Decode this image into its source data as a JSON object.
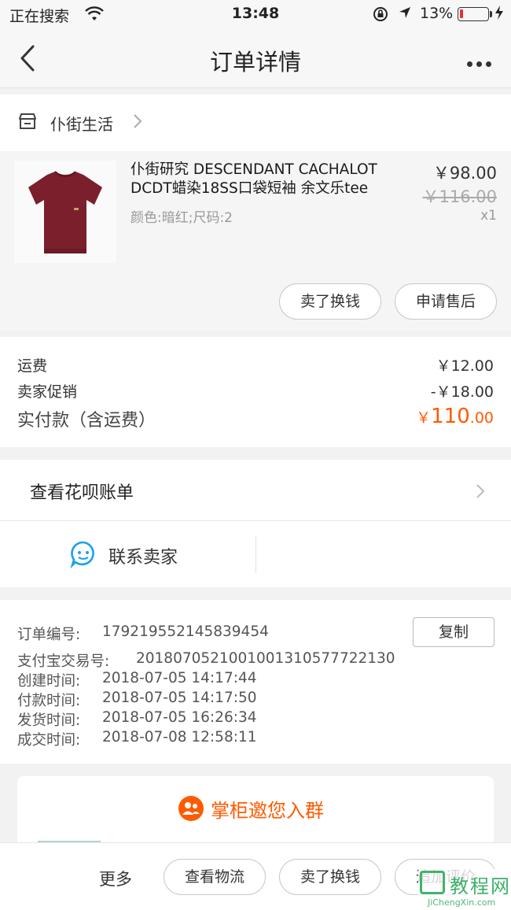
{
  "status_bar": {
    "carrier": "正在搜索",
    "time": "13:48",
    "battery_pct": "13%",
    "battery_level": 0.13,
    "battery_color": "#e83030"
  },
  "nav": {
    "title": "订单详情",
    "back_icon": "chevron-left-icon",
    "more_icon": "more-dots-icon"
  },
  "store": {
    "name": "仆街生活",
    "icon": "shop-icon"
  },
  "product": {
    "title": "仆街研究 DESCENDANT CACHALOT DCDT蜡染18SS口袋短袖 余文乐tee",
    "spec": "颜色:暗红;尺码:2",
    "price": "￥98.00",
    "original_price": "￥116.00",
    "quantity": "x1",
    "image_color": "#7a1f2b",
    "buttons": {
      "sell": "卖了换钱",
      "after_sale": "申请售后"
    }
  },
  "fees": {
    "shipping_label": "运费",
    "shipping_value": "￥12.00",
    "promo_label": "卖家促销",
    "promo_value": "-￥18.00",
    "total_label": "实付款（含运费）",
    "total_currency": "￥",
    "total_int": "110",
    "total_dec": ".00",
    "accent": "#ff5a00"
  },
  "huabei": {
    "label": "查看花呗账单"
  },
  "contact": {
    "label": "联系卖家",
    "icon": "chat-bubble-icon"
  },
  "order_info": {
    "copy_label": "复制",
    "rows": [
      {
        "label": "订单编号:",
        "value": "179219552145839454"
      },
      {
        "label": "支付宝交易号:",
        "value": "2018070521001001310577722130"
      },
      {
        "label": "创建时间:",
        "value": "2018-07-05 14:17:44"
      },
      {
        "label": "付款时间:",
        "value": "2018-07-05 14:17:50"
      },
      {
        "label": "发货时间:",
        "value": "2018-07-05 16:26:34"
      },
      {
        "label": "成交时间:",
        "value": "2018-07-08 12:58:11"
      }
    ]
  },
  "invite": {
    "label": "掌柜邀您入群"
  },
  "bottom_bar": {
    "more": "更多",
    "logistics": "查看物流",
    "sell": "卖了换钱",
    "review": "追加评价"
  },
  "watermark": {
    "text": "教程网",
    "url": "JiChengXin.com"
  }
}
